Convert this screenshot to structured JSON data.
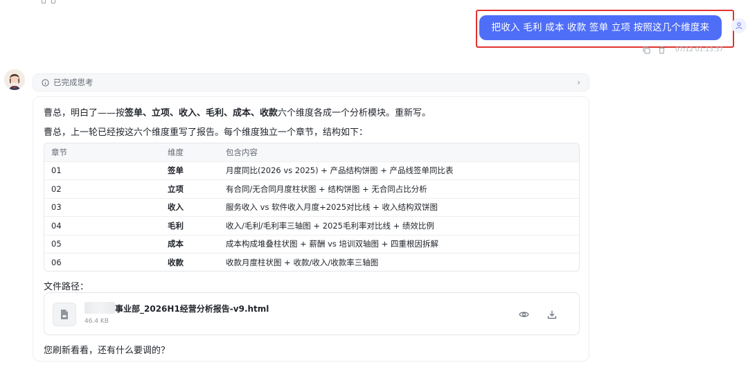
{
  "user_message": {
    "text": "把收入  毛利    成本  收款  签单 立项 按照这几个维度来",
    "timestamp": "07/12 01:13:37"
  },
  "thinking": {
    "label": "已完成思考"
  },
  "answer": {
    "line1_prefix": "曹总，明白了——按",
    "line1_bold": "签单、立项、收入、毛利、成本、收款",
    "line1_suffix": "六个维度各成一个分析模块。重新写。",
    "line2": "曹总，上一轮已经按这六个维度重写了报告。每个维度独立一个章节，结构如下：",
    "table": {
      "headers": [
        "章节",
        "维度",
        "包含内容"
      ],
      "rows": [
        [
          "01",
          "签单",
          "月度同比(2026 vs 2025) + 产品结构饼图 + 产品线签单同比表"
        ],
        [
          "02",
          "立项",
          "有合同/无合同月度柱状图 + 结构饼图 + 无合同占比分析"
        ],
        [
          "03",
          "收入",
          "服务收入 vs 软件收入月度+2025对比线 + 收入结构双饼图"
        ],
        [
          "04",
          "毛利",
          "收入/毛利/毛利率三轴图 + 2025毛利率对比线 + 绩效比例"
        ],
        [
          "05",
          "成本",
          "成本构成堆叠柱状图 + 薪酬 vs 培训双轴图 + 四重根因拆解"
        ],
        [
          "06",
          "收款",
          "收款月度柱状图 + 收款/收入/收款率三轴图"
        ]
      ]
    },
    "path_label": "文件路径：",
    "file": {
      "name": "事业部_2026H1经营分析报告-v9.html",
      "size": "46.4 KB"
    },
    "closing": "您刷新看看，还有什么要调的？"
  },
  "icons": {
    "user_avatar": "person-icon",
    "bot_avatar": "assistant-avatar",
    "copy": "copy-icon",
    "delete": "trash-icon",
    "think": "info-circle-icon",
    "chevron": "chevron-right-icon",
    "file": "document-icon",
    "view": "eye-icon",
    "download": "download-icon"
  },
  "colors": {
    "user_bubble": "#4f6ef7",
    "highlight": "#e0332e"
  }
}
